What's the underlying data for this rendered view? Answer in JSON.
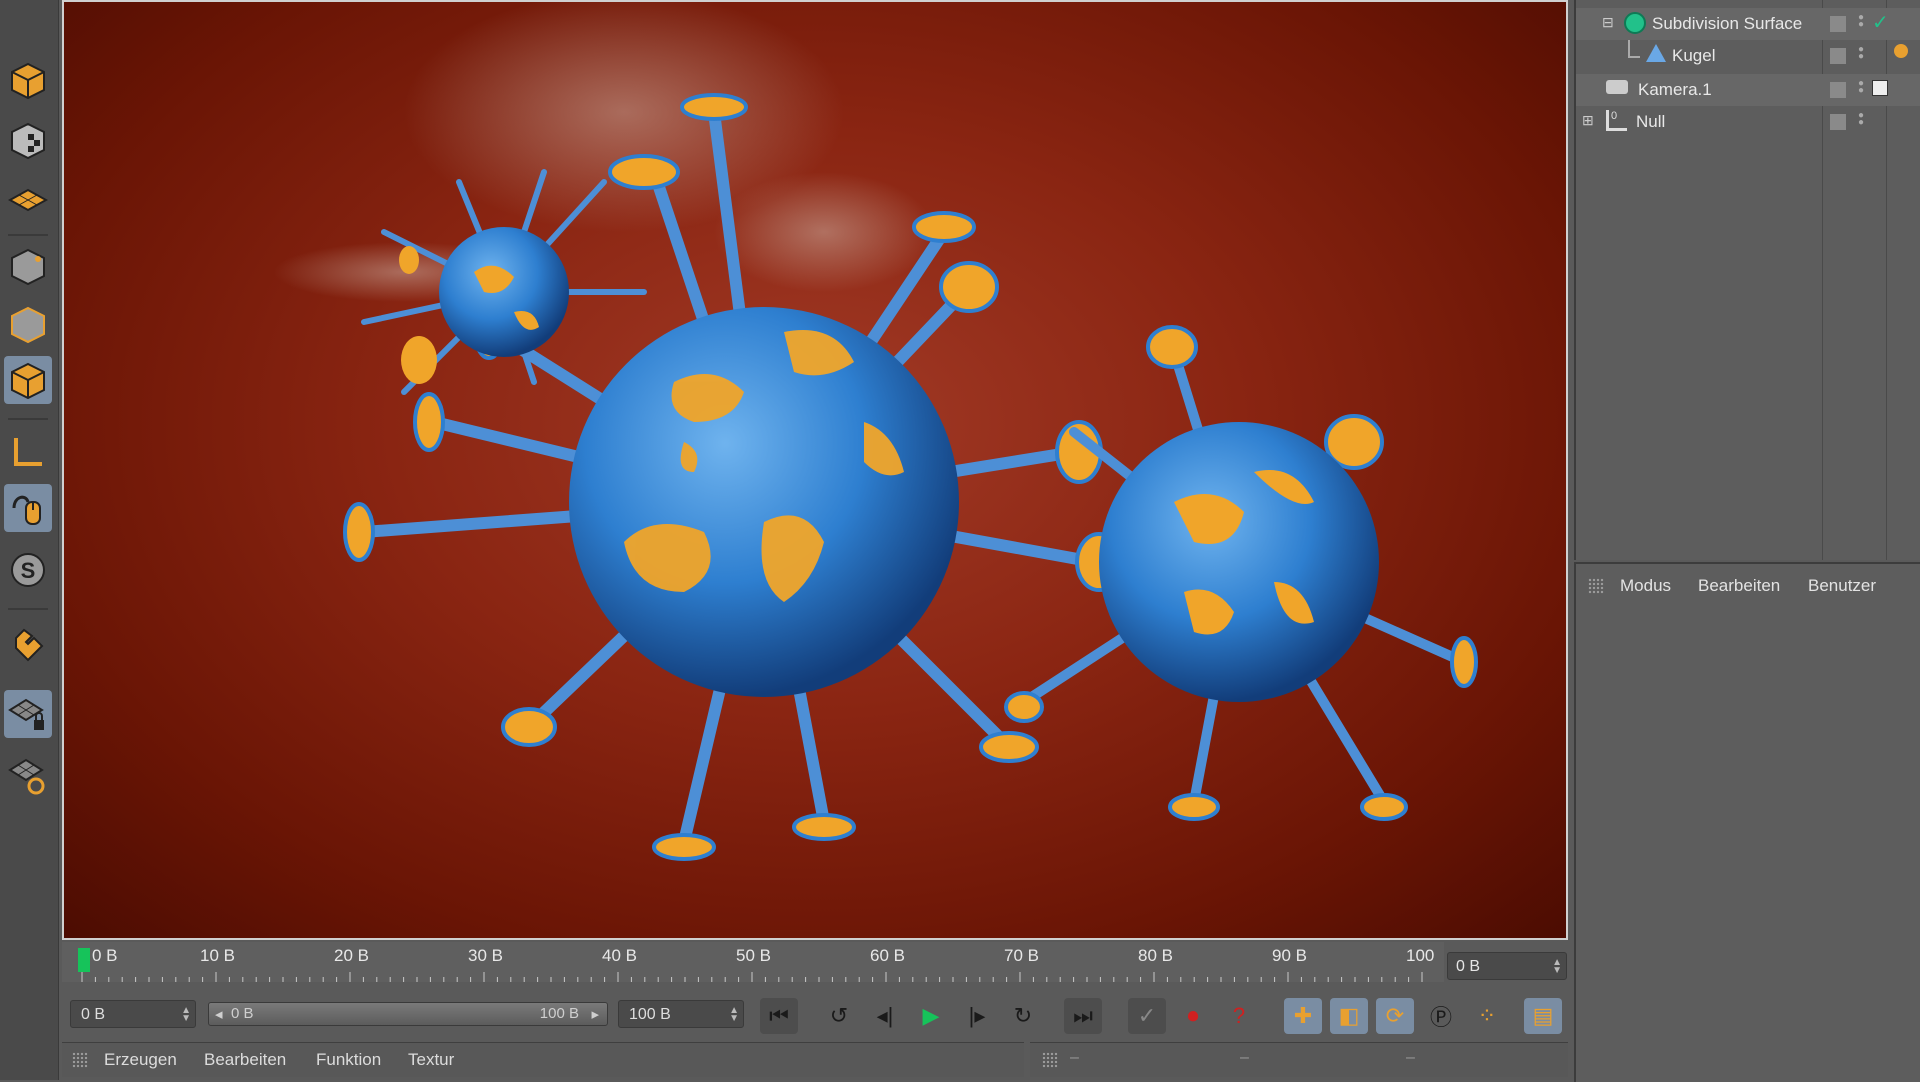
{
  "timeline": {
    "ticks": [
      "0 B",
      "10 B",
      "20 B",
      "30 B",
      "40 B",
      "50 B",
      "60 B",
      "70 B",
      "80 B",
      "90 B",
      "100"
    ],
    "current_frame": "0 B"
  },
  "transport": {
    "start_field": "0 B",
    "range_min": "0 B",
    "range_max": "100 B",
    "end_field": "100 B"
  },
  "material_menu": {
    "items": [
      "Erzeugen",
      "Bearbeiten",
      "Funktion",
      "Textur"
    ]
  },
  "coord_bar": {
    "placeholders": [
      "–",
      "–",
      "–"
    ]
  },
  "object_manager": {
    "objects": [
      {
        "name": "Subdivision Surface",
        "icon": "subdivision-surface-icon"
      },
      {
        "name": "Kugel",
        "icon": "sphere-icon"
      },
      {
        "name": "Kamera.1",
        "icon": "camera-icon"
      },
      {
        "name": "Null",
        "icon": "null-object-icon"
      }
    ]
  },
  "attribute_manager": {
    "menu": [
      "Modus",
      "Bearbeiten",
      "Benutzer"
    ]
  },
  "colors": {
    "accent_blue": "#7a8da3",
    "playhead_green": "#16c35a",
    "background_red": "#8a2512",
    "virus_blue": "#2e7fd0",
    "virus_orange": "#f0a52a"
  }
}
